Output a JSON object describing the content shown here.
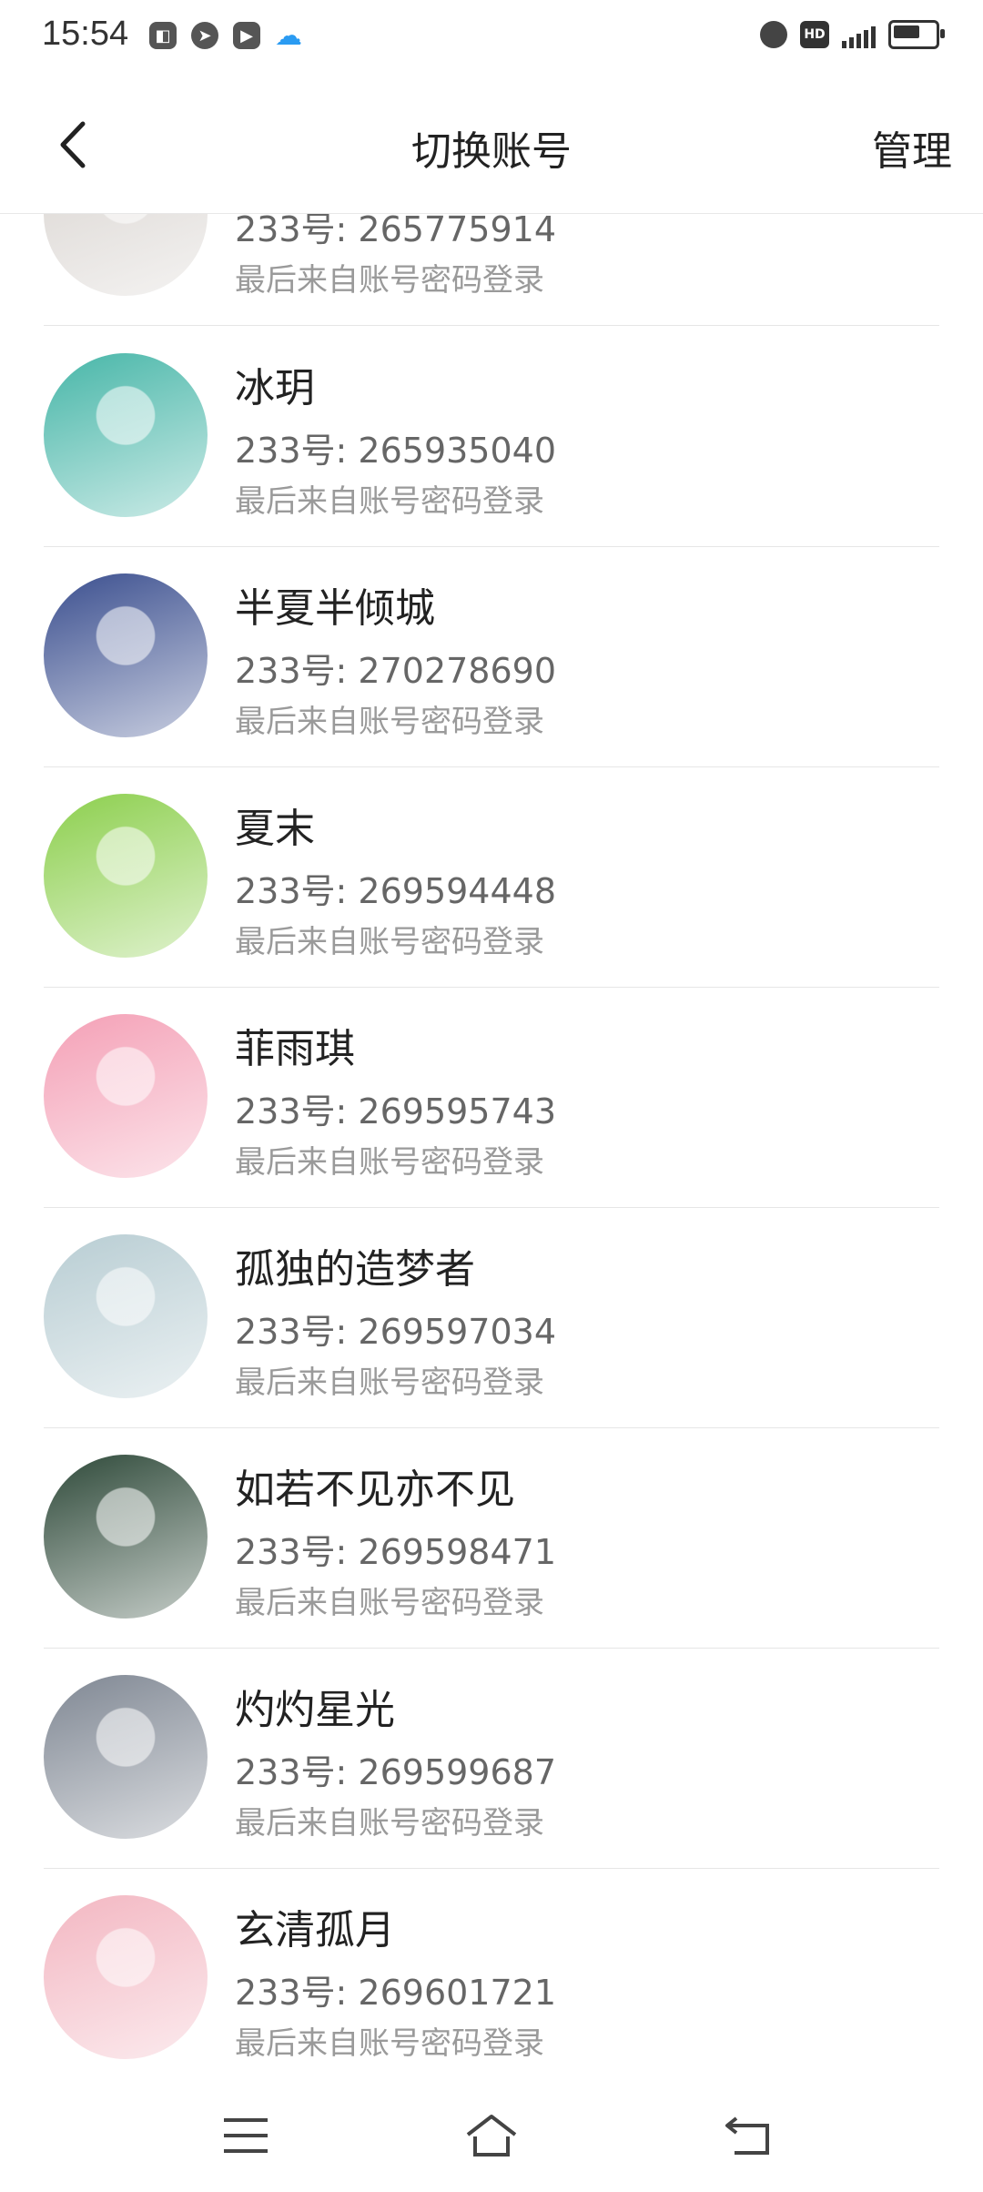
{
  "status_bar": {
    "time": "15:54",
    "left_icons": [
      "app-icon",
      "compass-icon",
      "play-icon",
      "cloud-icon"
    ],
    "right_icons": [
      "alarm-icon",
      "hd-icon",
      "signal-5g-icon",
      "battery-icon"
    ],
    "hd_text": "HD"
  },
  "header": {
    "title": "切换账号",
    "manage_label": "管理",
    "back_icon": "chevron-left-icon"
  },
  "accounts": [
    {
      "name": "",
      "id_label": "233号: 265775914",
      "login": "最后来自账号密码登录",
      "avatar_color": "#d8d3cf"
    },
    {
      "name": "冰玥",
      "id_label": "233号: 265935040",
      "login": "最后来自账号密码登录",
      "avatar_color": "#47b6a8"
    },
    {
      "name": "半夏半倾城",
      "id_label": "233号: 270278690",
      "login": "最后来自账号密码登录",
      "avatar_color": "#3b4f8f"
    },
    {
      "name": "夏末",
      "id_label": "233号: 269594448",
      "login": "最后来自账号密码登录",
      "avatar_color": "#8ccf4d"
    },
    {
      "name": "菲雨琪",
      "id_label": "233号: 269595743",
      "login": "最后来自账号密码登录",
      "avatar_color": "#f4a0b6"
    },
    {
      "name": "孤独的造梦者",
      "id_label": "233号: 269597034",
      "login": "最后来自账号密码登录",
      "avatar_color": "#b8cdd3"
    },
    {
      "name": "如若不见亦不见",
      "id_label": "233号: 269598471",
      "login": "最后来自账号密码登录",
      "avatar_color": "#2f4a3a"
    },
    {
      "name": "灼灼星光",
      "id_label": "233号: 269599687",
      "login": "最后来自账号密码登录",
      "avatar_color": "#7f8793"
    },
    {
      "name": "玄清孤月",
      "id_label": "233号: 269601721",
      "login": "最后来自账号密码登录",
      "avatar_color": "#f3b7c2"
    }
  ],
  "nav_bar": {
    "icons": [
      "menu-icon",
      "home-icon",
      "back-icon"
    ]
  }
}
